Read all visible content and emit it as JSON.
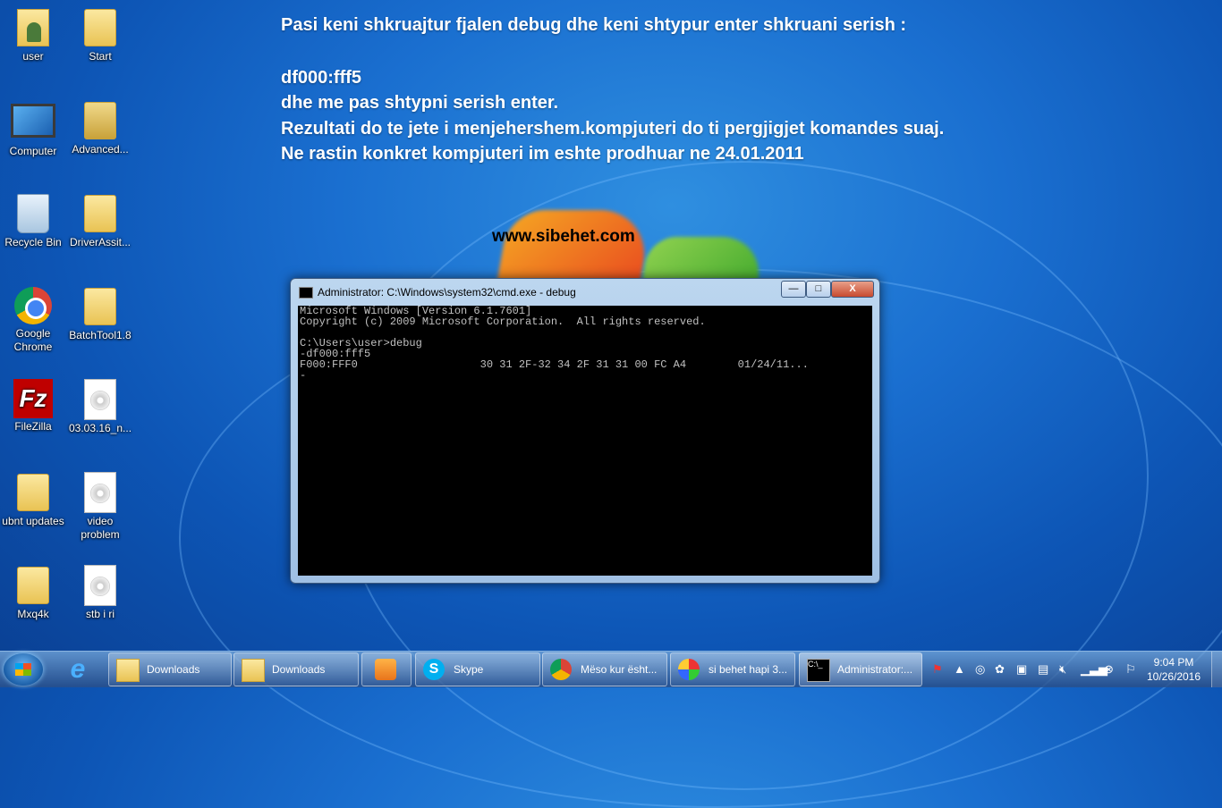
{
  "desktop": {
    "icons": [
      {
        "label": "user",
        "kind": "user-folder"
      },
      {
        "label": "Start",
        "kind": "folder"
      },
      {
        "label": "Computer",
        "kind": "computer"
      },
      {
        "label": "Advanced...",
        "kind": "folder"
      },
      {
        "label": "Recycle Bin",
        "kind": "recycle-bin"
      },
      {
        "label": "DriverAssit...",
        "kind": "folder"
      },
      {
        "label": "Google Chrome",
        "kind": "chrome"
      },
      {
        "label": "BatchTool1.8",
        "kind": "folder"
      },
      {
        "label": "FileZilla",
        "kind": "filezilla"
      },
      {
        "label": "03.03.16_n...",
        "kind": "disc"
      },
      {
        "label": "ubnt updates",
        "kind": "folder"
      },
      {
        "label": "video problem",
        "kind": "disc"
      },
      {
        "label": "Mxq4k",
        "kind": "folder"
      },
      {
        "label": "stb i ri",
        "kind": "disc"
      }
    ]
  },
  "overlay": {
    "line1": "Pasi keni shkruajtur fjalen debug dhe keni shtypur enter shkruani serish :",
    "line2": "df000:fff5",
    "line3": "dhe me pas shtypni serish enter.",
    "line4": "Rezultati do te jete i menjehershem.kompjuteri do ti pergjigjet komandes suaj.",
    "line5": "Ne rastin konkret kompjuteri im eshte prodhuar ne 24.01.2011",
    "website": "www.sibehet.com"
  },
  "cmd_window": {
    "title": "Administrator: C:\\Windows\\system32\\cmd.exe - debug",
    "minimize": "—",
    "maximize": "□",
    "close": "X",
    "lines": [
      "Microsoft Windows [Version 6.1.7601]",
      "Copyright (c) 2009 Microsoft Corporation.  All rights reserved.",
      "",
      "C:\\Users\\user>debug",
      "-df000:fff5",
      "F000:FFF0                   30 31 2F-32 34 2F 31 31 00 FC A4        01/24/11...",
      "-"
    ]
  },
  "taskbar": {
    "items": [
      {
        "label": "Downloads",
        "icon": "folder-icon"
      },
      {
        "label": "Downloads",
        "icon": "folder-icon"
      },
      {
        "label": "",
        "icon": "media-player-icon"
      },
      {
        "label": "Skype",
        "icon": "skype-icon"
      },
      {
        "label": "Mëso kur ësht...",
        "icon": "chrome-icon"
      },
      {
        "label": "si behet hapi 3...",
        "icon": "paint-icon"
      },
      {
        "label": "Administrator:...",
        "icon": "cmd-icon"
      }
    ],
    "clock_time": "9:04 PM",
    "clock_date": "10/26/2016"
  }
}
